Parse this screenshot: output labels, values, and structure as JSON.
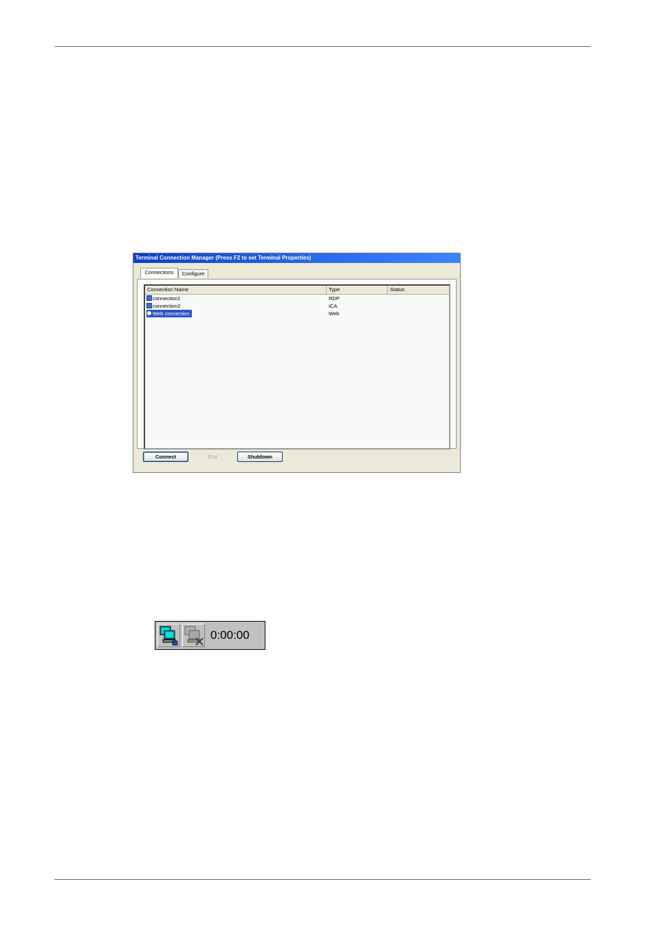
{
  "window": {
    "title": "Terminal Connection Manager (Press F2 to set Terminal Properties)",
    "tabs": [
      {
        "label": "Connections",
        "active": true
      },
      {
        "label": "Configure",
        "active": false
      }
    ],
    "columns": [
      "Connection Name",
      "Type",
      "Status"
    ],
    "rows": [
      {
        "name": "connection1",
        "type": "RDP",
        "status": "",
        "icon": "rdp-connection-icon",
        "selected": false
      },
      {
        "name": "connection2",
        "type": "ICA",
        "status": "",
        "icon": "ica-connection-icon",
        "selected": false
      },
      {
        "name": "Web connection",
        "type": "Web",
        "status": "",
        "icon": "web-connection-icon",
        "selected": true
      }
    ],
    "buttons": {
      "connect": "Connect",
      "end": "End",
      "shutdown": "Shutdown"
    },
    "colors": {
      "titlebar": "#0a3ec8",
      "selection": "#2a54c8"
    }
  },
  "tray": {
    "connected_icon": "network-connected-icon",
    "disconnected_icon": "network-disconnected-icon",
    "timer": "0:00:00"
  }
}
